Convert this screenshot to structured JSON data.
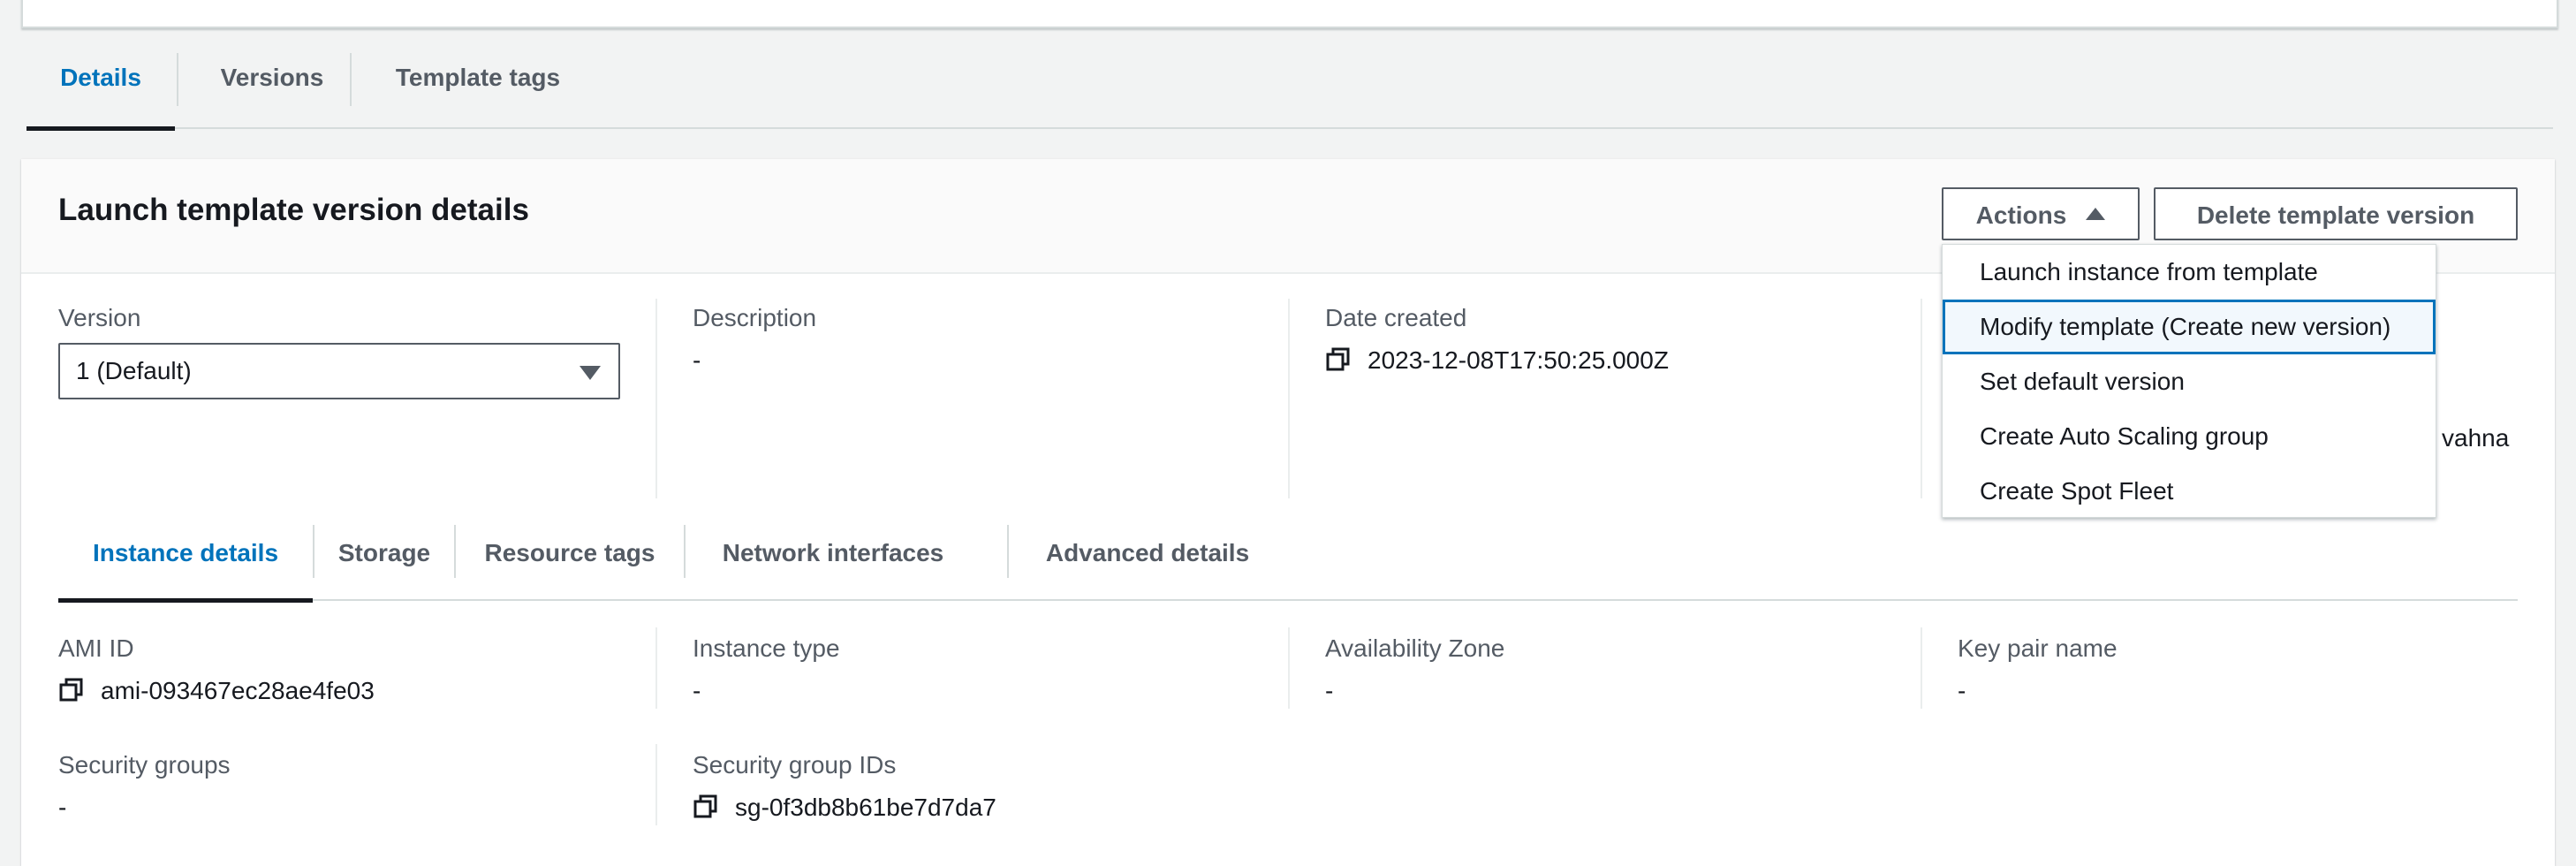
{
  "outer_tabs": [
    {
      "label": "Details",
      "active": true
    },
    {
      "label": "Versions",
      "active": false
    },
    {
      "label": "Template tags",
      "active": false
    }
  ],
  "panel": {
    "title": "Launch template version details",
    "actions_label": "Actions",
    "delete_label": "Delete template version"
  },
  "version": {
    "label": "Version",
    "selected": "1 (Default)"
  },
  "description": {
    "label": "Description",
    "value": "-"
  },
  "date_created": {
    "label": "Date created",
    "value": "2023-12-08T17:50:25.000Z"
  },
  "partial_col": {
    "line1": "-",
    "line2": "vahna"
  },
  "actions_menu": [
    {
      "label": "Launch instance from template"
    },
    {
      "label": "Modify template (Create new version)",
      "focused": true
    },
    {
      "label": "Set default version"
    },
    {
      "label": "Create Auto Scaling group"
    },
    {
      "label": "Create Spot Fleet"
    }
  ],
  "inner_tabs": [
    {
      "label": "Instance details",
      "active": true
    },
    {
      "label": "Storage"
    },
    {
      "label": "Resource tags"
    },
    {
      "label": "Network interfaces"
    },
    {
      "label": "Advanced details"
    }
  ],
  "instance_details": {
    "ami_id": {
      "label": "AMI ID",
      "value": "ami-093467ec28ae4fe03"
    },
    "instance_type": {
      "label": "Instance type",
      "value": "-"
    },
    "availability_zone": {
      "label": "Availability Zone",
      "value": "-"
    },
    "key_pair_name": {
      "label": "Key pair name",
      "value": "-"
    },
    "security_groups": {
      "label": "Security groups",
      "value": "-"
    },
    "security_group_ids": {
      "label": "Security group IDs",
      "value": "sg-0f3db8b61be7d7da7"
    }
  },
  "colors": {
    "accent": "#0073bb",
    "text": "#16191f",
    "muted": "#545b64",
    "border": "#d5dbdb"
  },
  "icons": {
    "copy": "copy-icon",
    "caret_up": "caret-up-icon",
    "caret_down": "caret-down-icon"
  }
}
